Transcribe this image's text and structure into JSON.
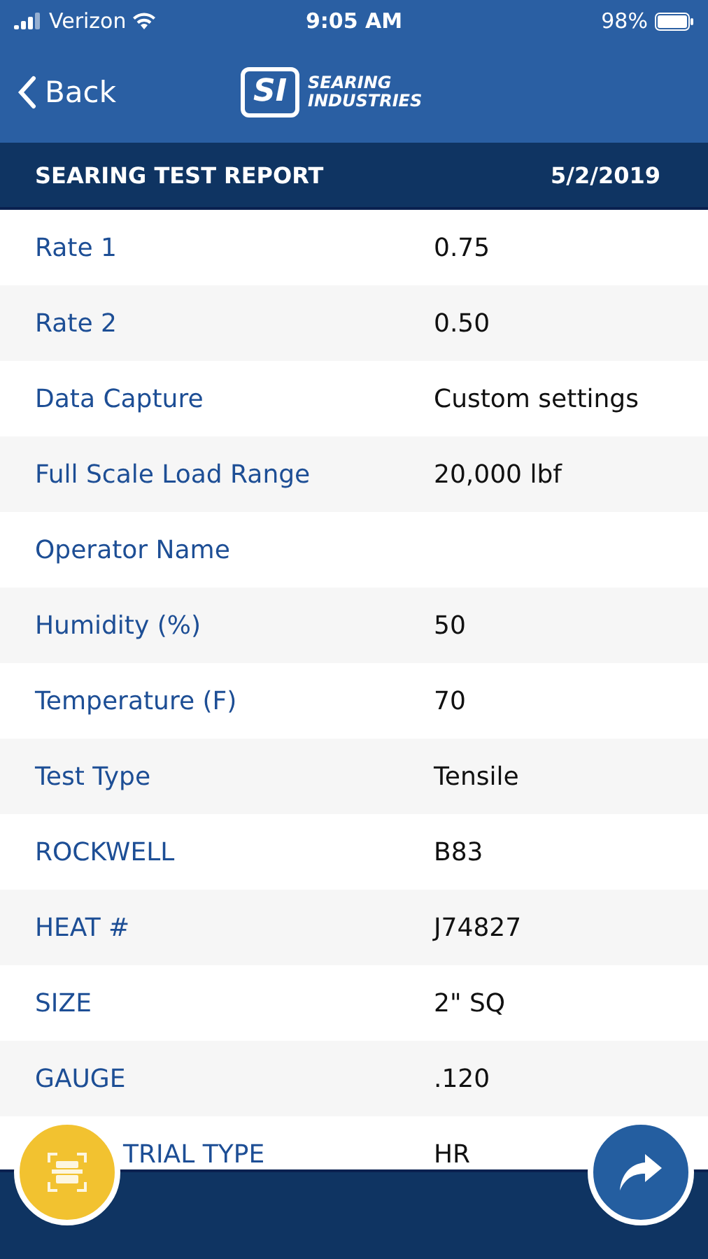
{
  "status_bar": {
    "carrier": "Verizon",
    "time": "9:05 AM",
    "battery": "98%"
  },
  "nav": {
    "back": "Back",
    "logo_mark": "SI",
    "logo_line_1": "SEARING",
    "logo_line_2": "INDUSTRIES"
  },
  "report_header": {
    "title": "SEARING TEST REPORT",
    "date": "5/2/2019"
  },
  "rows": [
    {
      "label": "Rate 1",
      "value": "0.75"
    },
    {
      "label": "Rate 2",
      "value": "0.50"
    },
    {
      "label": "Data Capture",
      "value": "Custom settings"
    },
    {
      "label": "Full Scale Load Range",
      "value": "20,000 lbf"
    },
    {
      "label": "Operator Name"
    },
    {
      "label": "Humidity (%)",
      "value": "50"
    },
    {
      "label": "Temperature (F)",
      "value": "70"
    },
    {
      "label": "Test Type",
      "value": "Tensile"
    },
    {
      "label": "ROCKWELL",
      "value": "B83"
    },
    {
      "label": "HEAT #",
      "value": "J74827"
    },
    {
      "label": "SIZE",
      "value": "2\" SQ"
    },
    {
      "label": "GAUGE",
      "value": ".120"
    },
    {
      "label": "TRIAL TYPE",
      "value": "HR",
      "partial": true
    }
  ]
}
